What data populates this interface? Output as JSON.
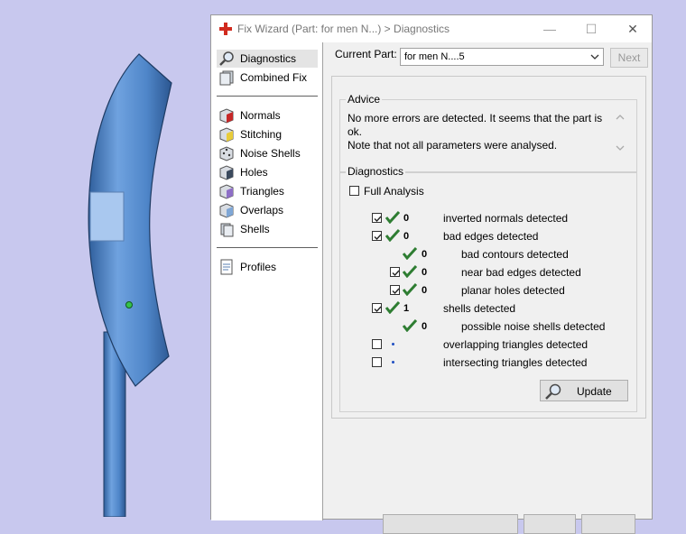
{
  "window": {
    "title": "Fix Wizard (Part: for men N...) > Diagnostics",
    "min_symbol": "—",
    "max_symbol": "☐",
    "close_symbol": "✕",
    "icon": "red-cross-icon"
  },
  "sidebar": {
    "items": [
      {
        "label": "Diagnostics",
        "icon": "magnifier-icon"
      },
      {
        "label": "Combined Fix",
        "icon": "layers-icon"
      },
      {
        "label": "Normals",
        "icon": "normals-cube-icon"
      },
      {
        "label": "Stitching",
        "icon": "stitching-cube-icon"
      },
      {
        "label": "Noise Shells",
        "icon": "noise-shells-cube-icon"
      },
      {
        "label": "Holes",
        "icon": "holes-cube-icon"
      },
      {
        "label": "Triangles",
        "icon": "triangles-cube-icon"
      },
      {
        "label": "Overlaps",
        "icon": "overlaps-cube-icon"
      },
      {
        "label": "Shells",
        "icon": "shells-icon"
      },
      {
        "label": "Profiles",
        "icon": "profile-document-icon"
      }
    ],
    "selected": "Diagnostics"
  },
  "current_part": {
    "label": "Current Part:",
    "value": "for men N....5"
  },
  "next_button": "Next",
  "advice": {
    "title": "Advice",
    "line1": "No more errors are detected. It seems that the part is ok.",
    "line2": "Note that not all parameters were analysed."
  },
  "diagnostics": {
    "title": "Diagnostics",
    "full_analysis_label": "Full Analysis",
    "full_analysis_checked": false,
    "rows": [
      {
        "label": "inverted normals detected",
        "count": "0",
        "checked": true,
        "status": "ok"
      },
      {
        "label": "bad edges detected",
        "count": "0",
        "checked": true,
        "status": "ok"
      },
      {
        "label": "bad contours detected",
        "count": "0",
        "status": "ok"
      },
      {
        "label": "near bad edges detected",
        "count": "0",
        "checked": true,
        "status": "ok"
      },
      {
        "label": "planar holes detected",
        "count": "0",
        "checked": true,
        "status": "ok"
      },
      {
        "label": "shells detected",
        "count": "1",
        "checked": true,
        "status": "ok"
      },
      {
        "label": "possible noise shells detected",
        "count": "0",
        "status": "ok"
      },
      {
        "label": "overlapping triangles detected",
        "count": "",
        "checked": false,
        "status": "not-analysed"
      },
      {
        "label": "intersecting triangles detected",
        "count": "",
        "checked": false,
        "status": "not-analysed"
      }
    ]
  },
  "update_button": "Update",
  "colors": {
    "viewport_bg": "#c8c8ee",
    "part_blue": "#4f86c9",
    "check_green": "#2e7d32",
    "status_dot": "#1f4fc2"
  }
}
